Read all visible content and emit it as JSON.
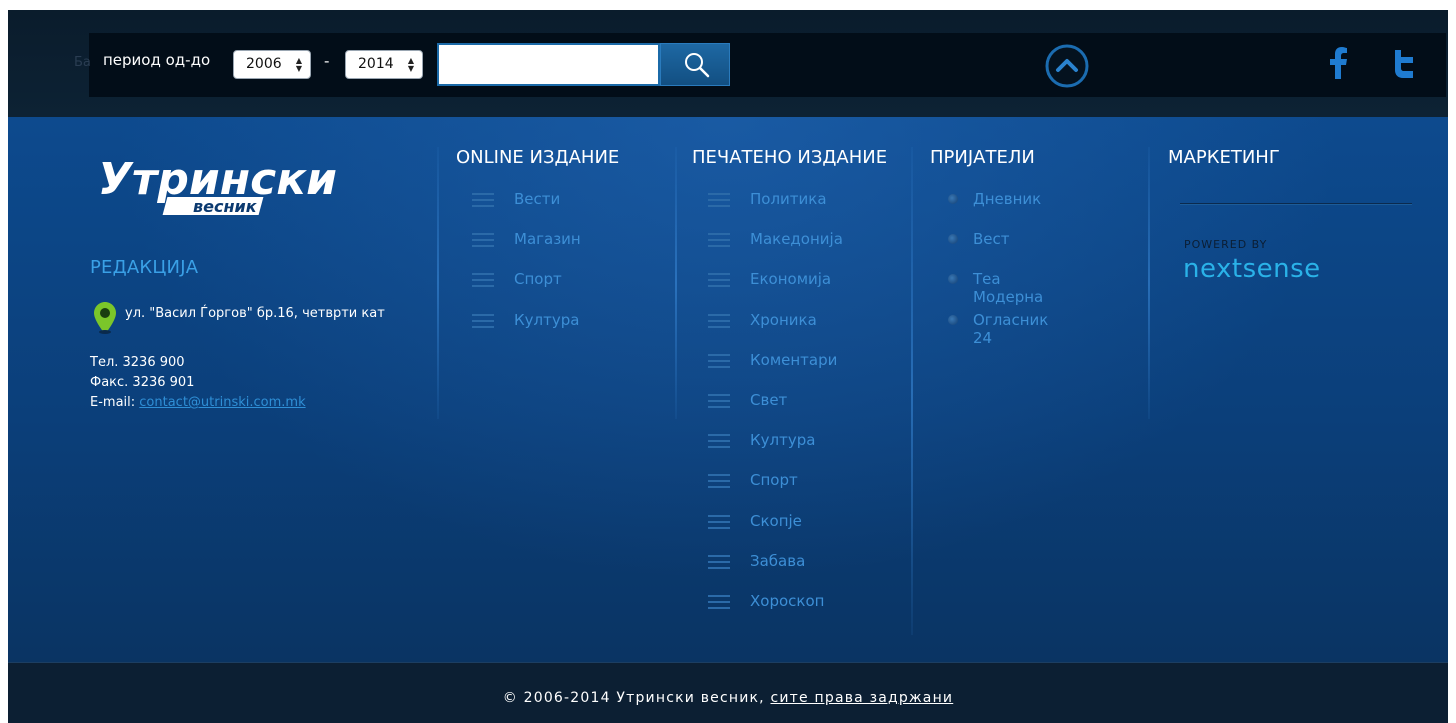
{
  "search": {
    "ghost_text": "Ба",
    "period_label": "период од-до",
    "year_from": "2006",
    "year_to": "2014",
    "dash": "-",
    "query_value": ""
  },
  "brand": {
    "logo_main": "Утрински",
    "logo_sub": "весник"
  },
  "redakcija": {
    "title": "РЕДАКЦИЈА",
    "address": "ул. \"Васил Ѓоргов\" бр.16, четврти кат",
    "phone": "Тел. 3236 900",
    "fax": "Факс. 3236 901",
    "email_label": "E-mail:",
    "email": "contact@utrinski.com.mk"
  },
  "online": {
    "title": "ONLINE ИЗДАНИЕ",
    "items": [
      "Вести",
      "Магазин",
      "Спорт",
      "Култура"
    ]
  },
  "print": {
    "title": "ПЕЧАТЕНО ИЗДАНИЕ",
    "items": [
      "Политика",
      "Македонија",
      "Економија",
      "Хроника",
      "Коментари",
      "Свет",
      "Култура",
      "Спорт",
      "Скопје",
      "Забава",
      "Хороскоп"
    ]
  },
  "friends": {
    "title": "ПРИЈАТЕЛИ",
    "items": [
      "Дневник",
      "Вест",
      "Теа Модерна",
      "Огласник 24"
    ]
  },
  "marketing": {
    "title": "МАРКЕТИНГ",
    "powered_by": "POWERED BY",
    "partner": "nextsense"
  },
  "footer": {
    "copyright": "© 2006-2014 Утрински весник,",
    "rights_link": "сите права задржани"
  },
  "icons": {
    "search": "search-icon",
    "scroll_top": "chevron-up-circle-icon",
    "facebook": "facebook-icon",
    "twitter": "twitter-icon",
    "location": "map-pin-icon"
  },
  "colors": {
    "accent": "#3aa0e6",
    "link": "#3d8fd6",
    "footer_bg": "#0c1f33"
  }
}
